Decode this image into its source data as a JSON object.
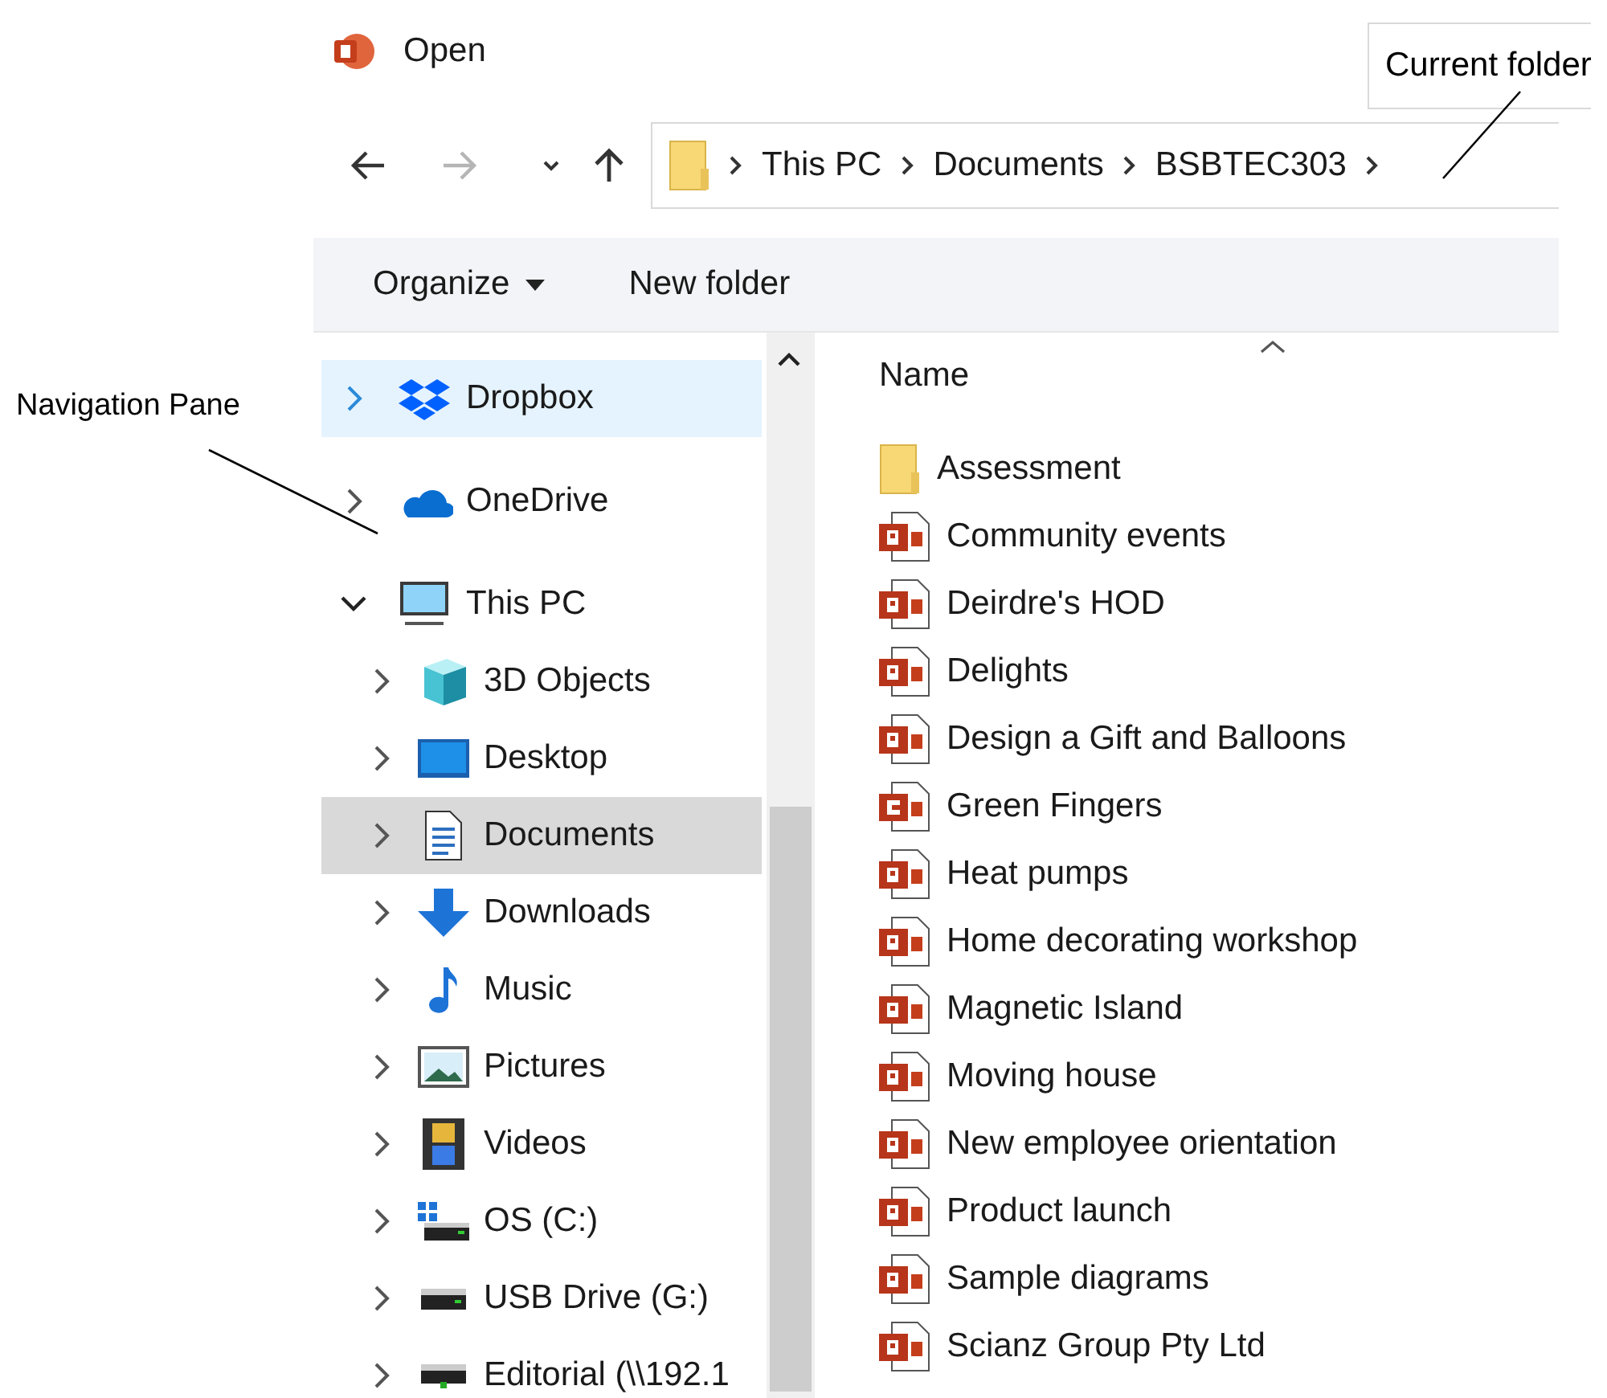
{
  "annotations": [
    {
      "text": "Current folder",
      "kind": "address"
    },
    {
      "text": "Navigation Pane",
      "kind": "navigation"
    }
  ],
  "window": {
    "title": "Open"
  },
  "nav_buttons": [
    {
      "kind": "back",
      "disabled": false
    },
    {
      "kind": "forward",
      "disabled": true
    },
    {
      "kind": "recent",
      "disabled": false
    },
    {
      "kind": "up",
      "disabled": false
    }
  ],
  "address_bar": {
    "path": [
      "This PC",
      "Documents",
      "BSBTEC303"
    ]
  },
  "toolbar": {
    "buttons": [
      {
        "label": "Organize",
        "kind": "menu"
      },
      {
        "label": "New folder",
        "kind": "plain"
      }
    ]
  },
  "navigation_pane": {
    "items": [
      {
        "label": "Dropbox",
        "kind": "dropbox",
        "expanded": false,
        "hovered": true,
        "selected": false
      },
      {
        "label": "OneDrive",
        "kind": "cloud",
        "expanded": false,
        "hovered": false,
        "selected": false
      },
      {
        "label": "This PC",
        "kind": "computer",
        "expanded": true,
        "hovered": false,
        "selected": false,
        "children": [
          {
            "label": "3D Objects",
            "kind": "cube",
            "expanded": false,
            "hovered": false,
            "selected": false
          },
          {
            "label": "Desktop",
            "kind": "desktop",
            "expanded": false,
            "hovered": false,
            "selected": false
          },
          {
            "label": "Documents",
            "kind": "document",
            "expanded": false,
            "hovered": false,
            "selected": true
          },
          {
            "label": "Downloads",
            "kind": "download",
            "expanded": false,
            "hovered": false,
            "selected": false
          },
          {
            "label": "Music",
            "kind": "music",
            "expanded": false,
            "hovered": false,
            "selected": false
          },
          {
            "label": "Pictures",
            "kind": "pictures",
            "expanded": false,
            "hovered": false,
            "selected": false
          },
          {
            "label": "Videos",
            "kind": "film",
            "expanded": false,
            "hovered": false,
            "selected": false
          },
          {
            "label": "OS (C:)",
            "kind": "system_drive",
            "expanded": false,
            "hovered": false,
            "selected": false
          },
          {
            "label": "USB Drive (G:)",
            "kind": "drive",
            "expanded": false,
            "hovered": false,
            "selected": false
          },
          {
            "label": "Editorial (\\\\192.1",
            "kind": "network_drive",
            "expanded": false,
            "hovered": false,
            "selected": false
          }
        ]
      }
    ]
  },
  "file_list": {
    "columns": [
      {
        "label": "Name",
        "sorted": true
      }
    ],
    "rows": [
      {
        "name": "Assessment",
        "kind": "folder"
      },
      {
        "name": "Community events",
        "kind": "presentation"
      },
      {
        "name": "Deirdre's HOD",
        "kind": "presentation"
      },
      {
        "name": "Delights",
        "kind": "presentation"
      },
      {
        "name": "Design a Gift and Balloons",
        "kind": "presentation"
      },
      {
        "name": "Green Fingers",
        "kind": "slideshow"
      },
      {
        "name": "Heat pumps",
        "kind": "presentation"
      },
      {
        "name": "Home decorating workshop",
        "kind": "presentation"
      },
      {
        "name": "Magnetic Island",
        "kind": "presentation"
      },
      {
        "name": "Moving house",
        "kind": "presentation"
      },
      {
        "name": "New employee orientation",
        "kind": "presentation"
      },
      {
        "name": "Product launch",
        "kind": "presentation"
      },
      {
        "name": "Sample diagrams",
        "kind": "presentation"
      },
      {
        "name": "Scianz Group Pty Ltd",
        "kind": "presentation"
      }
    ]
  }
}
